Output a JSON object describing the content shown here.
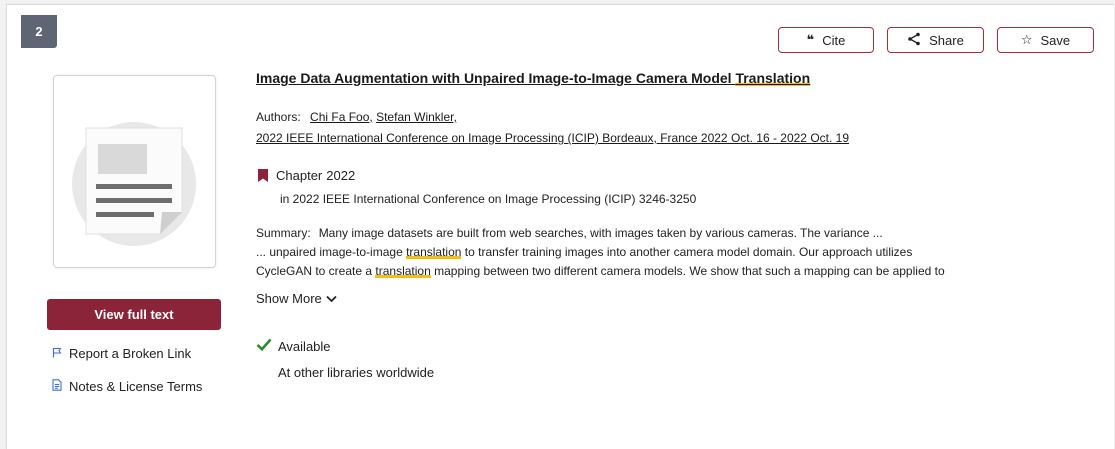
{
  "result": {
    "index": "2",
    "title_pre": "Image Data Augmentation with Unpaired Image-to-Image Camera Model ",
    "title_hl": "Translation",
    "authors_label": "Authors:",
    "authors": [
      "Chi Fa Foo,",
      "Stefan Winkler,"
    ],
    "conference": "2022 IEEE International Conference on Image Processing (ICIP) Bordeaux, France 2022 Oct. 16 - 2022 Oct. 19",
    "type": "Chapter",
    "year": "2022",
    "source": "in 2022 IEEE International Conference on Image Processing (ICIP)  3246-3250",
    "summary_label": "Summary:",
    "summary_line1": "Many image datasets are built from web searches, with images taken by various cameras. The variance ...",
    "summary_line2_a": "... unpaired image-to-image ",
    "summary_line2_hl": "translation",
    "summary_line2_b": " to transfer training images into another camera model domain. Our approach utilizes",
    "summary_line3_a": "CycleGAN to create a ",
    "summary_line3_hl": "translation",
    "summary_line3_b": " mapping between two different camera models. We show that such a mapping can be applied to",
    "show_more": "Show More",
    "availability": "Available",
    "availability_detail": "At other libraries worldwide"
  },
  "actions": {
    "cite": "Cite",
    "share": "Share",
    "save": "Save"
  },
  "sidebar": {
    "full_text": "View full text",
    "report_link": "Report a Broken Link",
    "notes": "Notes & License Terms"
  },
  "colors": {
    "brand": "#8b2339",
    "highlight": "#f2c012",
    "available": "#2e8b2e",
    "link_icon": "#3a6fd8",
    "badge": "#5e6673"
  },
  "icons": {
    "cite": "quote-icon",
    "share": "share-icon",
    "save": "star-icon",
    "report": "flag-icon",
    "notes": "document-icon",
    "type": "bookmark-icon",
    "available": "checkmark-icon",
    "show_more": "chevron-down-icon"
  }
}
